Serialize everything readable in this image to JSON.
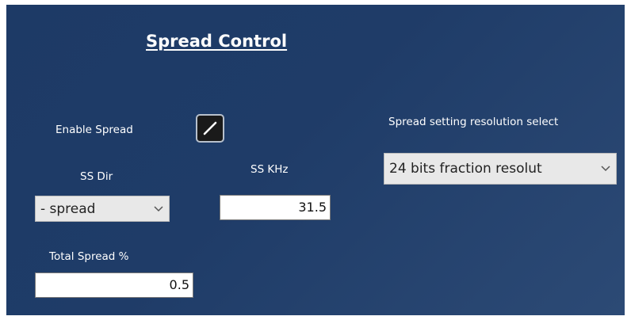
{
  "panel": {
    "title": "Spread Control"
  },
  "enable_spread": {
    "label": "Enable Spread",
    "checked": true
  },
  "resolution": {
    "label": "Spread setting resolution select",
    "selected": "24 bits fraction resolut"
  },
  "ss_dir": {
    "label": "SS Dir",
    "selected": "- spread"
  },
  "ss_khz": {
    "label": "SS KHz",
    "value": "31.5"
  },
  "total_spread": {
    "label": "Total Spread %",
    "value": "0.5"
  },
  "icons": {
    "checkbox_mark": "check-slash-icon",
    "dropdown": "chevron-down-icon"
  },
  "colors": {
    "panel_background": "#1f3c68",
    "text": "#ffffff",
    "control_background": "#e8e8e8"
  }
}
